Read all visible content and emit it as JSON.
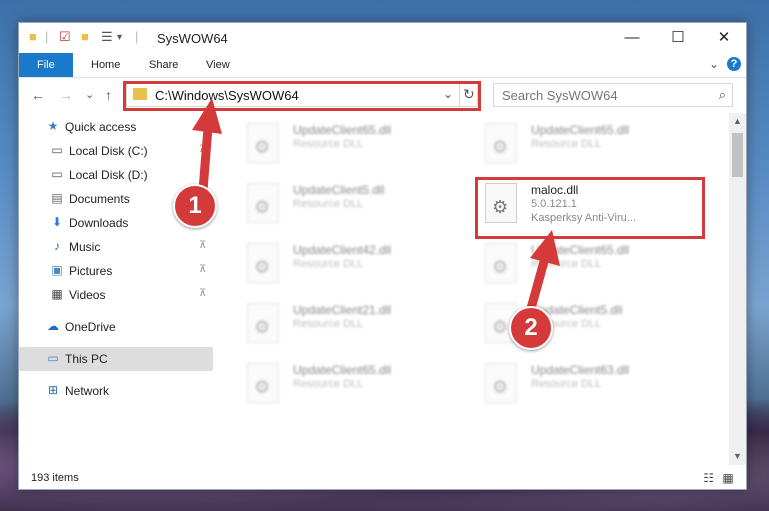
{
  "window": {
    "title": "SysWOW64",
    "controls": {
      "minimize": "—",
      "maximize": "☐",
      "close": "✕"
    }
  },
  "ribbon": {
    "tabs": [
      "File",
      "Home",
      "Share",
      "View"
    ],
    "expand": "⌄",
    "help": "?"
  },
  "nav": {
    "back": "←",
    "forward": "→",
    "recent": "⌄",
    "up": "↑",
    "address": "C:\\Windows\\SysWOW64",
    "dropdown": "⌄",
    "refresh": "↻",
    "search_placeholder": "Search SysWOW64"
  },
  "sidebar": {
    "items": [
      {
        "label": "Quick access",
        "icon": "star-icon",
        "glyph": "★",
        "color": "#3d7ac8"
      },
      {
        "label": "Local Disk (C:)",
        "icon": "drive-icon",
        "glyph": "▭",
        "color": "#555555",
        "pinned": true
      },
      {
        "label": "Local Disk (D:)",
        "icon": "drive-icon",
        "glyph": "▭",
        "color": "#555555",
        "pinned": true
      },
      {
        "label": "Documents",
        "icon": "documents-icon",
        "glyph": "▤",
        "color": "#666666",
        "pinned": true
      },
      {
        "label": "Downloads",
        "icon": "download-icon",
        "glyph": "⬇",
        "color": "#2a7ad0",
        "pinned": true
      },
      {
        "label": "Music",
        "icon": "music-icon",
        "glyph": "♪",
        "color": "#2a6ab0",
        "pinned": true
      },
      {
        "label": "Pictures",
        "icon": "pictures-icon",
        "glyph": "▣",
        "color": "#4a8ac0",
        "pinned": true
      },
      {
        "label": "Videos",
        "icon": "videos-icon",
        "glyph": "▦",
        "color": "#444444",
        "pinned": true
      },
      {
        "label": "OneDrive",
        "icon": "cloud-icon",
        "glyph": "☁",
        "color": "#1f6fc0"
      },
      {
        "label": "This PC",
        "icon": "computer-icon",
        "glyph": "▭",
        "color": "#3a8ad8",
        "selected": true
      },
      {
        "label": "Network",
        "icon": "network-icon",
        "glyph": "⊞",
        "color": "#2a6ab0"
      }
    ],
    "pin_glyph": "📌"
  },
  "files": [
    {
      "name": "UpdateClient65.dll",
      "line1": "Resource DLL",
      "line2": "",
      "blurred": true
    },
    {
      "name": "UpdateClient65.dll",
      "line1": "Resource DLL",
      "line2": "",
      "blurred": true
    },
    {
      "name": "UpdateClient5.dll",
      "line1": "Resource DLL",
      "line2": "",
      "blurred": true
    },
    {
      "name": "maloc.dll",
      "line1": "5.0.121.1",
      "line2": "Kasperksy Anti-Viru...",
      "blurred": false
    },
    {
      "name": "UpdateClient42.dll",
      "line1": "Resource DLL",
      "line2": "",
      "blurred": true
    },
    {
      "name": "UpdateClient65.dll",
      "line1": "Resource DLL",
      "line2": "",
      "blurred": true
    },
    {
      "name": "UpdateClient21.dll",
      "line1": "Resource DLL",
      "line2": "",
      "blurred": true
    },
    {
      "name": "UpdateClient5.dll",
      "line1": "Resource DLL",
      "line2": "",
      "blurred": true
    },
    {
      "name": "UpdateClient65.dll",
      "line1": "Resource DLL",
      "line2": "",
      "blurred": true
    },
    {
      "name": "UpdateClient63.dll",
      "line1": "Resource DLL",
      "line2": "",
      "blurred": true
    }
  ],
  "status": {
    "count": "193 items",
    "view_details": "☷",
    "view_tiles": "▦"
  },
  "callouts": {
    "one": "1",
    "two": "2"
  },
  "colors": {
    "accent": "#1979ca",
    "highlight": "#d43a3a"
  }
}
